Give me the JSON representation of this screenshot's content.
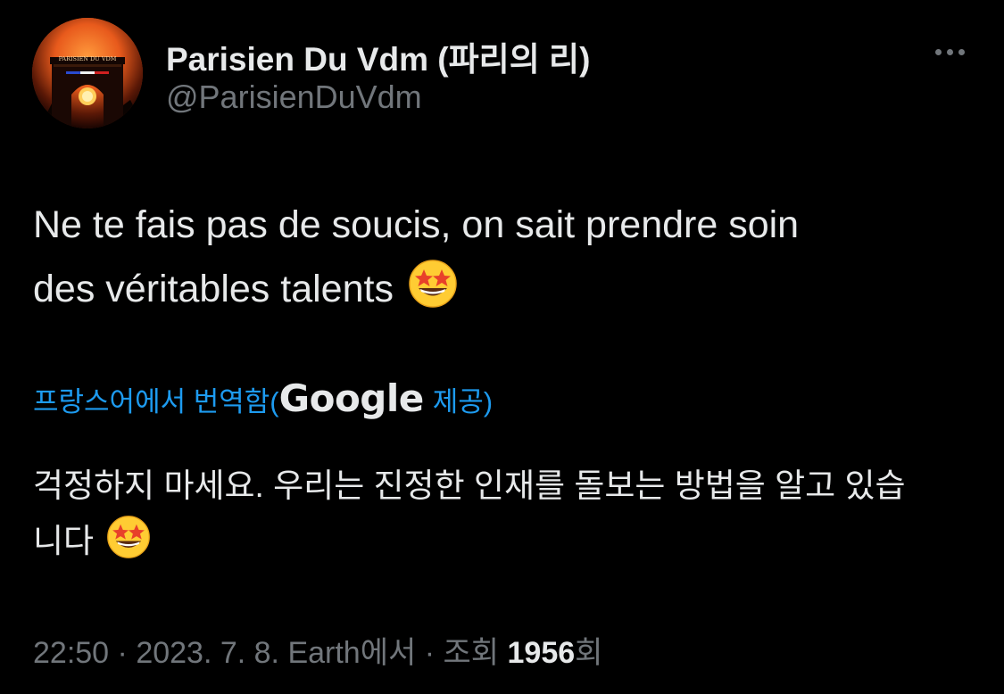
{
  "author": {
    "display_name": "Parisien Du Vdm (파리의 리)",
    "handle": "@ParisienDuVdm",
    "avatar_caption": "PARISIEN DU VDM"
  },
  "menu": {
    "more_icon": "more-horizontal-icon"
  },
  "tweet": {
    "line1": "Ne te fais pas de soucis, on sait prendre soin",
    "line2": "des véritables talents",
    "emoji": "star-struck-emoji"
  },
  "translation": {
    "prefix": "프랑스어에서 번역함(",
    "provider": "Google",
    "suffix": "제공)",
    "line1": "걱정하지 마세요. 우리는 진정한 인재를 돌보는 방법을 알고 있습",
    "line2": "니다"
  },
  "meta": {
    "time": "22:50",
    "sep1": " · ",
    "date": "2023. 7. 8.",
    "source": " Earth에서",
    "sep2": " · ",
    "views_label": "조회 ",
    "views_count": "1956",
    "views_suffix": "회"
  },
  "colors": {
    "background": "#000000",
    "text": "#e7e9ea",
    "secondary": "#71767b",
    "link": "#1d9bf0"
  }
}
